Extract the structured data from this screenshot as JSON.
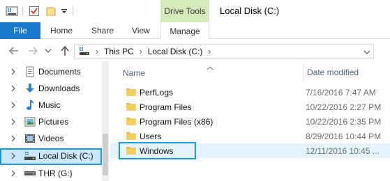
{
  "window": {
    "title": "Local Disk (C:)"
  },
  "contextual_tab_group": "Drive Tools",
  "ribbon": {
    "tabs": [
      {
        "label": "File"
      },
      {
        "label": "Home"
      },
      {
        "label": "Share"
      },
      {
        "label": "View"
      },
      {
        "label": "Manage"
      }
    ]
  },
  "address": {
    "crumbs": [
      "This PC",
      "Local Disk (C:)"
    ]
  },
  "nav_pane": {
    "items": [
      {
        "label": "Documents",
        "icon": "documents-icon"
      },
      {
        "label": "Downloads",
        "icon": "downloads-icon"
      },
      {
        "label": "Music",
        "icon": "music-icon"
      },
      {
        "label": "Pictures",
        "icon": "pictures-icon"
      },
      {
        "label": "Videos",
        "icon": "videos-icon"
      },
      {
        "label": "Local Disk (C:)",
        "icon": "local-disk-icon",
        "selected": true
      },
      {
        "label": "THR (G:)",
        "icon": "drive-icon"
      }
    ]
  },
  "file_list": {
    "columns": {
      "name": "Name",
      "date": "Date modified"
    },
    "rows": [
      {
        "name": "PerfLogs",
        "date": "7/16/2016 7:47 AM"
      },
      {
        "name": "Program Files",
        "date": "10/22/2016 2:27 PM"
      },
      {
        "name": "Program Files (x86)",
        "date": "10/22/2016 2:35 PM"
      },
      {
        "name": "Users",
        "date": "8/29/2016 10:44 PM"
      },
      {
        "name": "Windows",
        "date": "12/11/2016 10:45 ...",
        "selected": true
      }
    ]
  },
  "colors": {
    "accent": "#1979ca",
    "contextual_tab": "#d5eabb",
    "selection_outline": "#1a9bd7",
    "selection_fill": "#cce8ff",
    "folder": "#f6cf62"
  }
}
